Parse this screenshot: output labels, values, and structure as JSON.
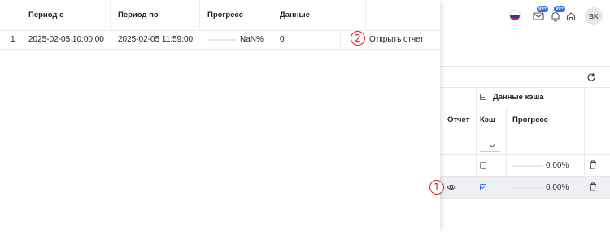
{
  "header": {
    "language": "ru",
    "mail_badge": "99+",
    "bell_badge": "99+",
    "avatar_initials": "BK"
  },
  "colors": {
    "accent": "#2f6bd8",
    "marker": "#dd2222",
    "flag": [
      "#ffffff",
      "#1c3faa",
      "#d52b1e"
    ]
  },
  "edge_text": {
    "top": "С",
    "mid": "с"
  },
  "background_table": {
    "group_header": "Данные кэша",
    "columns": {
      "report": "Отчет",
      "cache": "Кэш",
      "progress": "Прогресс"
    },
    "rows": [
      {
        "cache_checked": false,
        "progress_value": 0,
        "progress_text": "0.00%",
        "has_report_icon": false
      },
      {
        "cache_checked": true,
        "progress_value": 0,
        "progress_text": "0.00%",
        "has_report_icon": true
      }
    ]
  },
  "panel": {
    "columns": {
      "from": "Период с",
      "to": "Период по",
      "progress": "Прогресс",
      "data": "Данные"
    },
    "rows": [
      {
        "index": "1",
        "from": "2025-02-05 10:00:00",
        "to": "2025-02-05 11:59:00",
        "progress_value": 0,
        "progress_text": "NaN%",
        "data": "0",
        "action": "Открыть отчет"
      }
    ]
  },
  "markers": {
    "m1": "1",
    "m2": "2"
  }
}
